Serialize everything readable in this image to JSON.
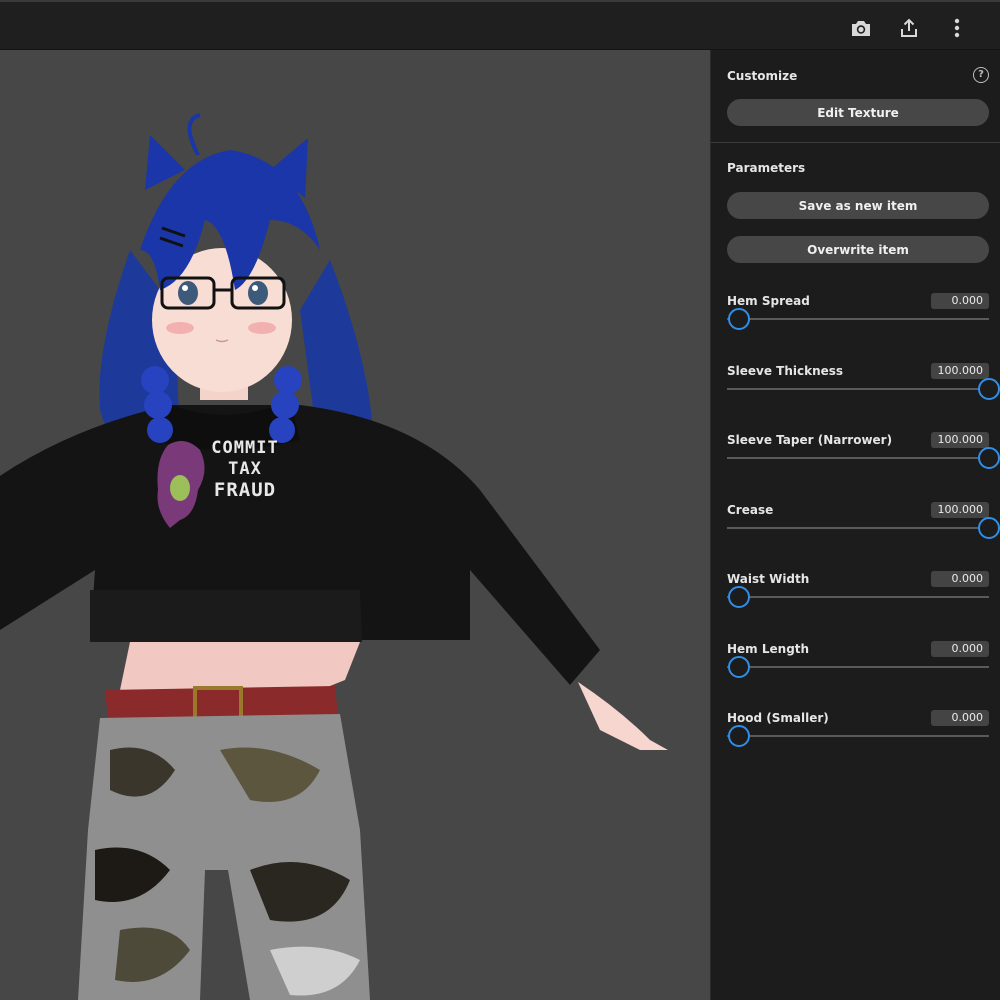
{
  "toolbar": {
    "icons": [
      "camera-icon",
      "share-icon",
      "more-vertical-icon"
    ]
  },
  "avatar": {
    "shirt_text": [
      "COMMIT",
      "TAX",
      "FRAUD"
    ]
  },
  "panel": {
    "customize": {
      "title": "Customize",
      "help_glyph": "?",
      "edit_texture_label": "Edit Texture"
    },
    "parameters": {
      "title": "Parameters",
      "save_label": "Save as new item",
      "overwrite_label": "Overwrite item",
      "items": [
        {
          "label": "Hem Spread",
          "value": "0.000",
          "fraction": 0.0
        },
        {
          "label": "Sleeve Thickness",
          "value": "100.000",
          "fraction": 1.0
        },
        {
          "label": "Sleeve Taper (Narrower)",
          "value": "100.000",
          "fraction": 1.0
        },
        {
          "label": "Crease",
          "value": "100.000",
          "fraction": 1.0
        },
        {
          "label": "Waist Width",
          "value": "0.000",
          "fraction": 0.0
        },
        {
          "label": "Hem Length",
          "value": "0.000",
          "fraction": 0.0
        },
        {
          "label": "Hood (Smaller)",
          "value": "0.000",
          "fraction": 0.0
        }
      ]
    }
  },
  "colors": {
    "accent": "#2f8ee6",
    "viewport_bg": "#474747",
    "panel_bg": "#1c1c1c"
  }
}
